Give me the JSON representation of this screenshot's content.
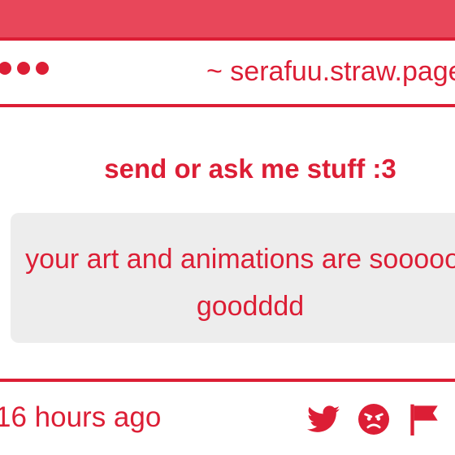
{
  "titlebar": {
    "url": "~ serafuu.straw.page"
  },
  "prompt": {
    "title": "send or ask me stuff :3"
  },
  "message": {
    "text": "your art and animations are soooooo goodddd"
  },
  "footer": {
    "timestamp": "16 hours ago",
    "icons": [
      "twitter-icon",
      "angry-face-icon",
      "flag-icon"
    ]
  },
  "colors": {
    "accent": "#dc1e35",
    "top_bar": "#e8475a",
    "message_bg": "#ededed"
  }
}
